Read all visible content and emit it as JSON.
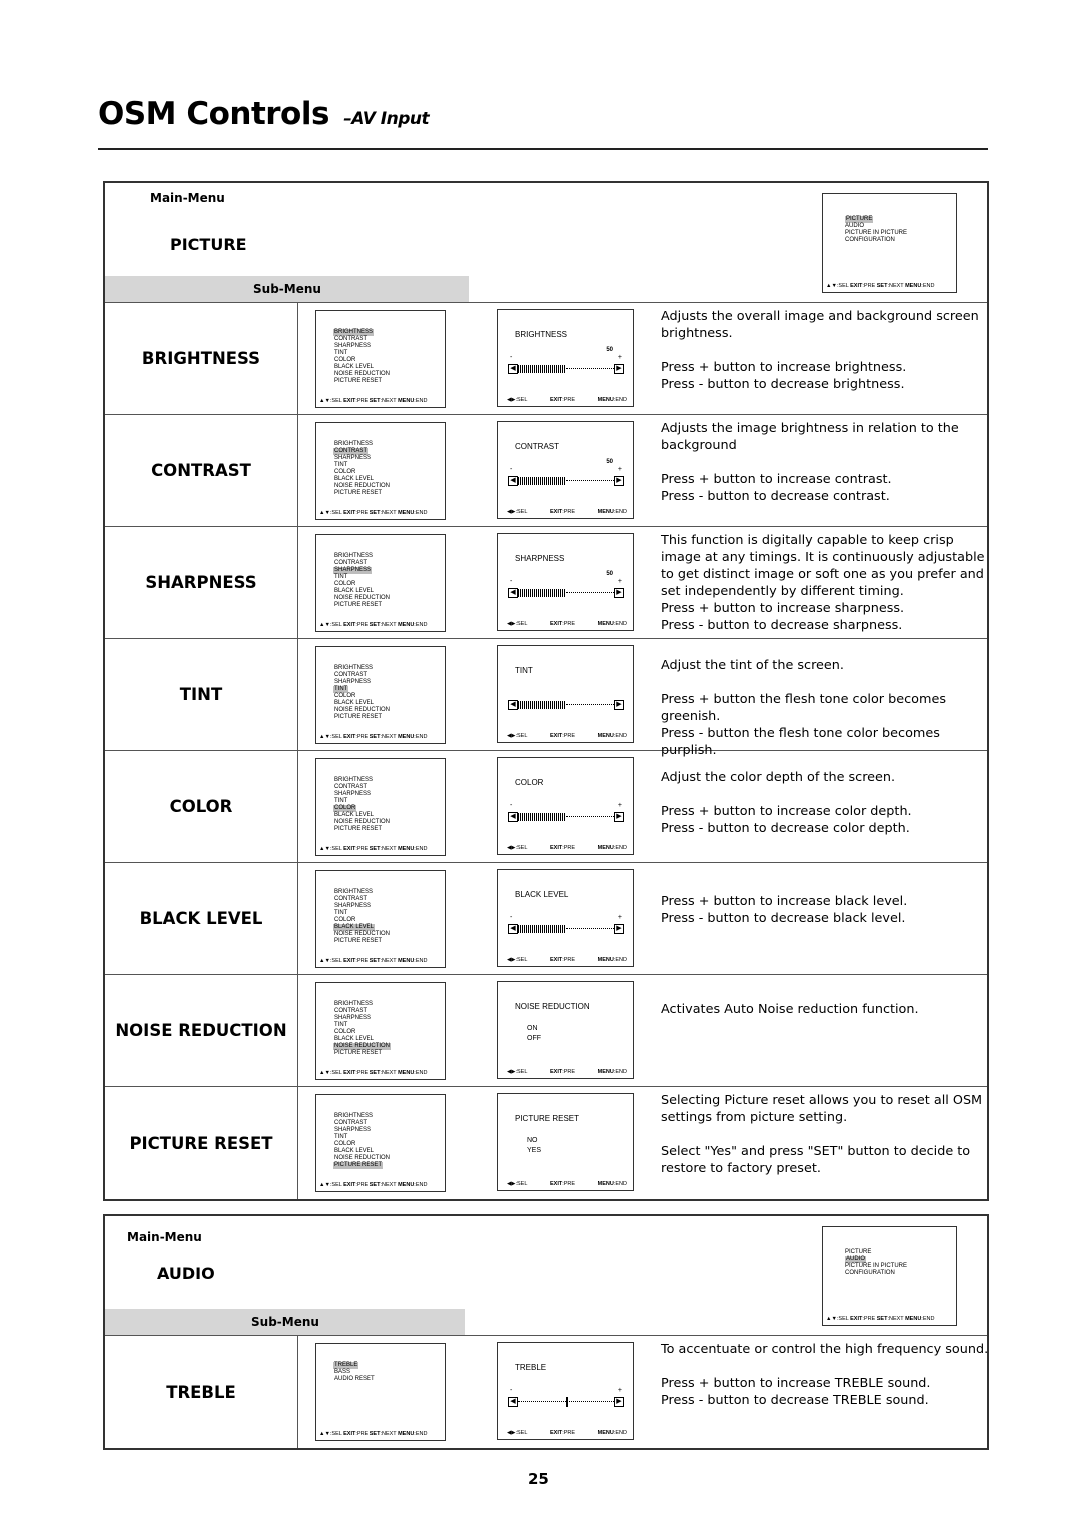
{
  "page": {
    "title": "OSM Controls",
    "subtitle": "–AV Input",
    "page_number": "25"
  },
  "osd_footer_main": {
    "arrows": "▲▼",
    "sel": ":SEL ",
    "exit": "EXIT",
    "pre": ":PRE ",
    "set": "SET",
    "next": ":NEXT ",
    "menu": "MENU",
    "end": ":END"
  },
  "osd_footer_adj": {
    "arrows": "◀▶",
    "sel": ":SEL",
    "exit": "EXIT",
    "pre": ":PRE",
    "menu": "MENU",
    "end": ":END"
  },
  "main_menu_items": [
    "PICTURE",
    "AUDIO",
    "PICTURE IN PICTURE",
    "CONFIGURATION"
  ],
  "picture_submenu_items": [
    "BRIGHTNESS",
    "CONTRAST",
    "SHARPNESS",
    "TINT",
    "COLOR",
    "BLACK LEVEL",
    "NOISE REDUCTION",
    "PICTURE RESET"
  ],
  "audio_submenu_items": [
    "TREBLE",
    "BASS",
    "AUDIO RESET"
  ],
  "sections": [
    {
      "main_label": "Main-Menu",
      "menu_name": "PICTURE",
      "sub_label": "Sub-Menu",
      "selected_main": 0,
      "rows": [
        {
          "label": "BRIGHTNESS",
          "osd_title": "BRIGHTNESS",
          "value": "50",
          "level": 0.5,
          "desc": [
            "Adjusts the overall image and background screen brightness.",
            "Press + button to increase brightness.",
            "Press - button to decrease brightness."
          ]
        },
        {
          "label": "CONTRAST",
          "osd_title": "CONTRAST",
          "value": "50",
          "level": 0.5,
          "desc": [
            "Adjusts the image brightness in relation to the background",
            "Press + button to increase contrast.",
            "Press - button to decrease contrast."
          ]
        },
        {
          "label": "SHARPNESS",
          "osd_title": "SHARPNESS",
          "value": "50",
          "level": 0.5,
          "desc": [
            "This function is digitally capable to keep crisp image at any timings.  It is continuously adjustable to get distinct image or soft one as you prefer and set independently by different timing.",
            "Press + button to increase sharpness.",
            "Press - button to decrease sharpness."
          ]
        },
        {
          "label": "TINT",
          "osd_title": "TINT",
          "level": 0.5,
          "desc": [
            "Adjust the tint of the screen.",
            "Press + button the flesh tone color becomes greenish.",
            "Press - button the flesh tone color becomes purplish."
          ]
        },
        {
          "label": "COLOR",
          "osd_title": "COLOR",
          "level": 0.5,
          "desc": [
            "Adjust the color depth of the screen.",
            "Press + button to increase color depth.",
            "Press - button to decrease color depth."
          ]
        },
        {
          "label": "BLACK LEVEL",
          "osd_title": "BLACK LEVEL",
          "level": 0.5,
          "desc": [
            "Press + button to increase black level.",
            "Press - button to decrease black level."
          ]
        },
        {
          "label": "NOISE REDUCTION",
          "osd_title": "NOISE REDUCTION",
          "options": [
            "ON",
            "OFF"
          ],
          "desc": [
            "Activates Auto Noise reduction function."
          ]
        },
        {
          "label": "PICTURE RESET",
          "osd_title": "PICTURE RESET",
          "options": [
            "NO",
            "YES"
          ],
          "desc": [
            "Selecting Picture reset allows you to reset all OSM settings from picture setting.",
            "Select \"Yes\" and press \"SET\" button to decide to restore to factory preset."
          ]
        }
      ]
    },
    {
      "main_label": "Main-Menu",
      "menu_name": "AUDIO",
      "sub_label": "Sub-Menu",
      "selected_main": 1,
      "rows": [
        {
          "label": "TREBLE",
          "osd_title": "TREBLE",
          "level": 0.5,
          "center_knob": true,
          "desc": [
            "To accentuate or control the high frequency sound.",
            "Press + button to increase TREBLE sound.",
            "Press - button to decrease TREBLE sound."
          ]
        }
      ]
    }
  ]
}
